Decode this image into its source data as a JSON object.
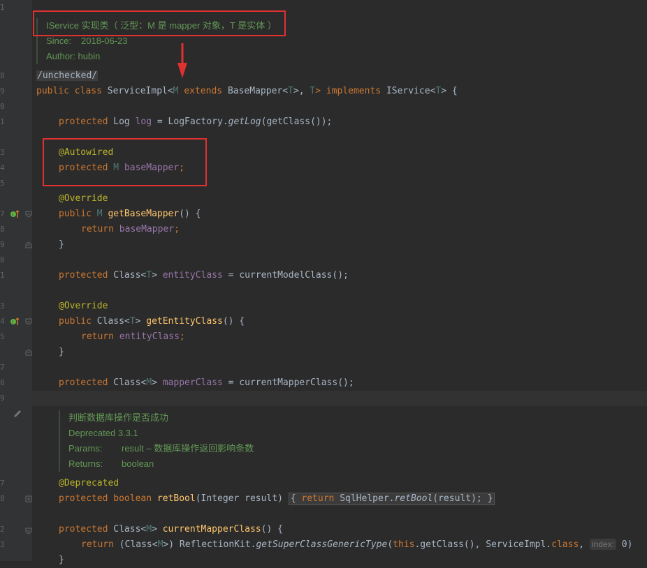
{
  "line_numbers": [
    "1",
    "8",
    "9",
    "0",
    "1",
    "3",
    "4",
    "5",
    "7",
    "8",
    "9",
    "0",
    "1",
    "3",
    "4",
    "5",
    "7",
    "8",
    "9",
    "7",
    "8",
    "2",
    "3"
  ],
  "doc_top": {
    "title": "IService 实现类（ 泛型：M 是 mapper 对象，T 是实体 ）",
    "since_label": "Since:",
    "since_value": "2018-06-23",
    "author": "Author: hubin"
  },
  "code": {
    "suppress": "/unchecked/",
    "class_decl": [
      "public class ",
      "ServiceImpl<",
      "M",
      " extends ",
      "BaseMapper<",
      "T",
      ">, ",
      "T",
      "> implements ",
      "IService<",
      "T",
      "> {"
    ],
    "log_decl": [
      "protected ",
      "Log ",
      "log",
      " = LogFactory.",
      "getLog",
      "(getClass());"
    ],
    "autowired": "@Autowired",
    "base_mapper_decl": [
      "protected ",
      "M ",
      "baseMapper",
      ";"
    ],
    "override1": "@Override",
    "get_base_mapper": [
      "public ",
      "M ",
      "getBaseMapper",
      "() {"
    ],
    "return_base_mapper": [
      "return ",
      "baseMapper",
      ";"
    ],
    "close_brace": "}",
    "entity_class_decl": [
      "protected ",
      "Class<",
      "T",
      "> ",
      "entityClass",
      " = currentModelClass();"
    ],
    "override2": "@Override",
    "get_entity_class": [
      "public ",
      "Class<",
      "T",
      "> ",
      "getEntityClass",
      "() {"
    ],
    "return_entity_class": [
      "return ",
      "entityClass",
      ";"
    ],
    "mapper_class_decl": [
      "protected ",
      "Class<",
      "M",
      "> ",
      "mapperClass",
      " = currentMapperClass();"
    ],
    "deprecated": "@Deprecated",
    "ret_bool": [
      "protected boolean ",
      "retBool",
      "(Integer result)",
      "{ ",
      "return ",
      "SqlHelper.",
      "retBool",
      "(result); ",
      "}"
    ],
    "current_mapper_class": [
      "protected ",
      "Class<",
      "M",
      "> ",
      "currentMapperClass",
      "() {"
    ],
    "return_reflection": [
      "return ",
      "(Class<",
      "M",
      ">) ReflectionKit.",
      "getSuperClassGenericType",
      "(",
      "this",
      ".getClass(), ServiceImpl.",
      "class",
      ", ",
      "index:",
      " 0",
      ")"
    ]
  },
  "doc_mid": {
    "summary": "判断数据库操作是否成功",
    "deprecated": "Deprecated 3.3.1",
    "params_label": "Params:",
    "params_value": "result – 数据库操作返回影响条数",
    "returns_label": "Returns:",
    "returns_value": "boolean"
  },
  "annotations_overlay": {
    "arrow_color": "#e03131",
    "box_color": "#e03131"
  }
}
